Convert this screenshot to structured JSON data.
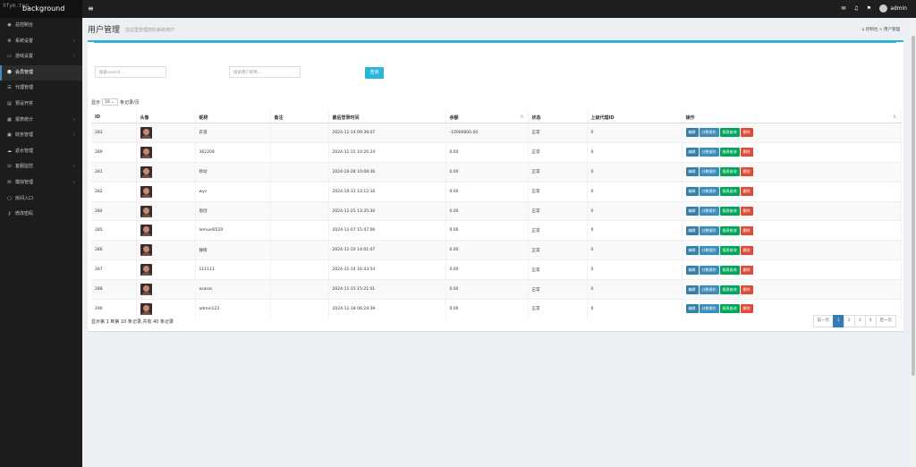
{
  "header": {
    "watermark": "9fym.top",
    "brand": "background",
    "menu_glyph": "≡",
    "icons": [
      "envelope-icon",
      "bell-icon",
      "flag-icon"
    ],
    "user": "admin"
  },
  "sidebar": {
    "items": [
      {
        "label": "总控制台",
        "icon": "gauge-icon",
        "glyph": "◉",
        "arrow": false,
        "active": false
      },
      {
        "label": "系统设置",
        "icon": "gear-icon",
        "glyph": "⚙",
        "arrow": true,
        "active": false
      },
      {
        "label": "游戏设置",
        "icon": "gamepad-icon",
        "glyph": "▭",
        "arrow": true,
        "active": false
      },
      {
        "label": "会员管理",
        "icon": "users-icon",
        "glyph": "☻",
        "arrow": false,
        "active": true
      },
      {
        "label": "代理管理",
        "icon": "agent-icon",
        "glyph": "☰",
        "arrow": false,
        "active": false
      },
      {
        "label": "预设开奖",
        "icon": "lottery-icon",
        "glyph": "▤",
        "arrow": false,
        "active": false
      },
      {
        "label": "报表统计",
        "icon": "report-icon",
        "glyph": "▦",
        "arrow": true,
        "active": false
      },
      {
        "label": "财务管理",
        "icon": "finance-icon",
        "glyph": "▣",
        "arrow": true,
        "active": false
      },
      {
        "label": "返水管理",
        "icon": "rebate-icon",
        "glyph": "☁",
        "arrow": false,
        "active": false
      },
      {
        "label": "客服监控",
        "icon": "service-icon",
        "glyph": "☏",
        "arrow": true,
        "active": false
      },
      {
        "label": "模拟管理",
        "icon": "sim-icon",
        "glyph": "✉",
        "arrow": true,
        "active": false
      },
      {
        "label": "房间入口",
        "icon": "room-icon",
        "glyph": "▢",
        "arrow": false,
        "active": false
      },
      {
        "label": "修改密码",
        "icon": "key-icon",
        "glyph": "⚷",
        "arrow": false,
        "active": false
      }
    ],
    "arrow_glyph": "‹"
  },
  "page": {
    "title": "用户管理",
    "subtitle": "在这里管理您的系统用户",
    "breadcrumb_home": "控制台",
    "breadcrumb_sep": ">",
    "breadcrumb_current": "用户管理"
  },
  "filters": {
    "userid_placeholder": "搜索userid...",
    "nickname_placeholder": "搜索用户昵称...",
    "search_button": "查询"
  },
  "page_length": {
    "prefix": "显示",
    "value": "10",
    "suffix": "条记录/页"
  },
  "table": {
    "columns": [
      "ID",
      "头像",
      "昵称",
      "备注",
      "最后登录时间",
      "余额",
      "状态",
      "上级代理ID",
      "操作"
    ],
    "rows": [
      {
        "id": "283",
        "nickname": "弈道",
        "remark": "",
        "last_login": "2024-11-14 09:39:07",
        "balance": "-10000000.00",
        "status": "正常",
        "parent": "0"
      },
      {
        "id": "289",
        "nickname": "362209",
        "remark": "",
        "last_login": "2024-11-15 10:26:24",
        "balance": "0.00",
        "status": "正常",
        "parent": "0"
      },
      {
        "id": "281",
        "nickname": "移动",
        "remark": "",
        "last_login": "2024-10-28 10:08:36",
        "balance": "0.00",
        "status": "正常",
        "parent": "0"
      },
      {
        "id": "282",
        "nickname": "wys",
        "remark": "",
        "last_login": "2024-10-31 13:12:16",
        "balance": "0.00",
        "status": "正常",
        "parent": "0"
      },
      {
        "id": "284",
        "nickname": "恩创",
        "remark": "",
        "last_login": "2024-11-25 13:35:30",
        "balance": "0.00",
        "status": "正常",
        "parent": "0"
      },
      {
        "id": "285",
        "nickname": "lemuel0520",
        "remark": "",
        "last_login": "2024-11-07 15:47:06",
        "balance": "0.00",
        "status": "正常",
        "parent": "0"
      },
      {
        "id": "286",
        "nickname": "静情",
        "remark": "",
        "last_login": "2024-11-10 14:01:07",
        "balance": "0.00",
        "status": "正常",
        "parent": "0"
      },
      {
        "id": "287",
        "nickname": "111111",
        "remark": "",
        "last_login": "2024-11-14 16:43:54",
        "balance": "0.00",
        "status": "正常",
        "parent": "0"
      },
      {
        "id": "288",
        "nickname": "asasss",
        "remark": "",
        "last_login": "2024-11-15 15:21:01",
        "balance": "0.00",
        "status": "正常",
        "parent": "0"
      },
      {
        "id": "290",
        "nickname": "admin123",
        "remark": "",
        "last_login": "2024-11-18 06:24:39",
        "balance": "0.00",
        "status": "正常",
        "parent": "0"
      }
    ],
    "actions": {
      "edit": "编辑",
      "split": "分数操作",
      "report": "报表查询",
      "delete": "删除"
    },
    "sort_glyph": "⇅"
  },
  "footer": {
    "info": "显示第 1 到第 10 条记录,共有 40 条记录",
    "prev": "前一页",
    "pages": [
      "1",
      "2",
      "3",
      "4"
    ],
    "next": "后一页"
  },
  "colors": {
    "accent": "#3c8dbc",
    "sidebar_bg": "#1c1c1c",
    "topbar_bg": "#1f1f1f",
    "success": "#00a65a",
    "danger": "#dd4b39",
    "info": "#29b6d9"
  }
}
